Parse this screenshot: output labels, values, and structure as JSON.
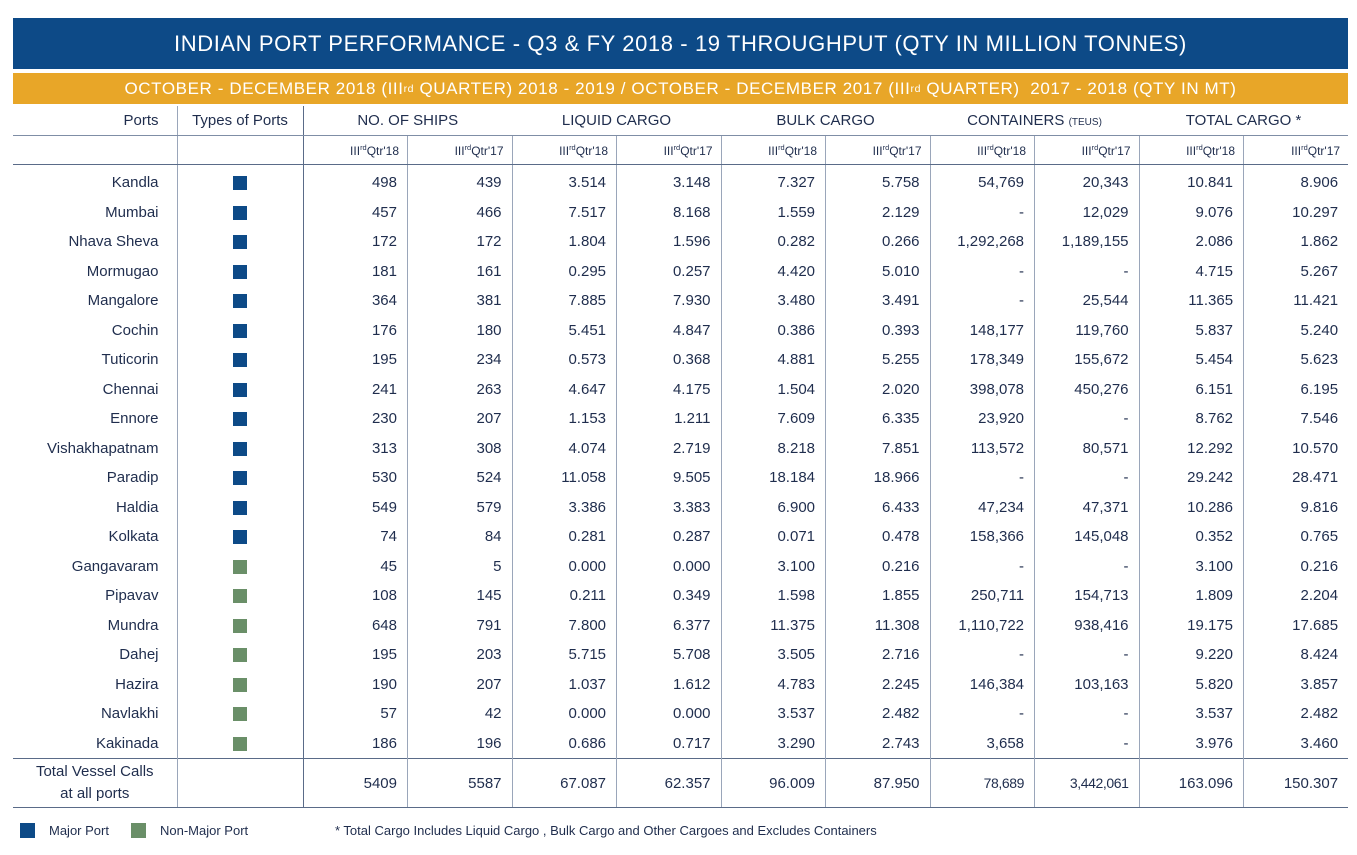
{
  "title": "INDIAN PORT PERFORMANCE - Q3 & FY 2018 - 19 THROUGHPUT (QTY IN MILLION TONNES)",
  "subtitle": {
    "part1": "OCTOBER - DECEMBER 2018 (III",
    "sup1": "rd",
    "part2": " QUARTER) 2018 - 2019 / OCTOBER - DECEMBER 2017 (III",
    "sup2": "rd",
    "part3": " QUARTER)  2017 - 2018 (QTY IN MT)"
  },
  "colors": {
    "title_bg": "#0d4a87",
    "subtitle_bg": "#e8a628",
    "major": "#0d4a87",
    "non_major": "#6a8f68"
  },
  "headers": {
    "ports": "Ports",
    "types": "Types of Ports",
    "ships": "NO. OF SHIPS",
    "liquid": "LIQUID CARGO",
    "bulk": "BULK CARGO",
    "containers": "CONTAINERS",
    "containers_unit": "(TEUS)",
    "total": "TOTAL CARGO *",
    "q18_prefix": "III",
    "q18_sup": "rd",
    "q18_suffix": "Qtr'18",
    "q17_prefix": "III",
    "q17_sup": "rd",
    "q17_suffix": "Qtr'17"
  },
  "rows": [
    [
      "Kandla",
      "major",
      "498",
      "439",
      "3.514",
      "3.148",
      "7.327",
      "5.758",
      "54,769",
      "20,343",
      "10.841",
      "8.906"
    ],
    [
      "Mumbai",
      "major",
      "457",
      "466",
      "7.517",
      "8.168",
      "1.559",
      "2.129",
      "-",
      "12,029",
      "9.076",
      "10.297"
    ],
    [
      "Nhava Sheva",
      "major",
      "172",
      "172",
      "1.804",
      "1.596",
      "0.282",
      "0.266",
      "1,292,268",
      "1,189,155",
      "2.086",
      "1.862"
    ],
    [
      "Mormugao",
      "major",
      "181",
      "161",
      "0.295",
      "0.257",
      "4.420",
      "5.010",
      "-",
      "-",
      "4.715",
      "5.267"
    ],
    [
      "Mangalore",
      "major",
      "364",
      "381",
      "7.885",
      "7.930",
      "3.480",
      "3.491",
      "-",
      "25,544",
      "11.365",
      "11.421"
    ],
    [
      "Cochin",
      "major",
      "176",
      "180",
      "5.451",
      "4.847",
      "0.386",
      "0.393",
      "148,177",
      "119,760",
      "5.837",
      "5.240"
    ],
    [
      "Tuticorin",
      "major",
      "195",
      "234",
      "0.573",
      "0.368",
      "4.881",
      "5.255",
      "178,349",
      "155,672",
      "5.454",
      "5.623"
    ],
    [
      "Chennai",
      "major",
      "241",
      "263",
      "4.647",
      "4.175",
      "1.504",
      "2.020",
      "398,078",
      "450,276",
      "6.151",
      "6.195"
    ],
    [
      "Ennore",
      "major",
      "230",
      "207",
      "1.153",
      "1.211",
      "7.609",
      "6.335",
      "23,920",
      "-",
      "8.762",
      "7.546"
    ],
    [
      "Vishakhapatnam",
      "major",
      "313",
      "308",
      "4.074",
      "2.719",
      "8.218",
      "7.851",
      "113,572",
      "80,571",
      "12.292",
      "10.570"
    ],
    [
      "Paradip",
      "major",
      "530",
      "524",
      "11.058",
      "9.505",
      "18.184",
      "18.966",
      "-",
      "-",
      "29.242",
      "28.471"
    ],
    [
      "Haldia",
      "major",
      "549",
      "579",
      "3.386",
      "3.383",
      "6.900",
      "6.433",
      "47,234",
      "47,371",
      "10.286",
      "9.816"
    ],
    [
      "Kolkata",
      "major",
      "74",
      "84",
      "0.281",
      "0.287",
      "0.071",
      "0.478",
      "158,366",
      "145,048",
      "0.352",
      "0.765"
    ],
    [
      "Gangavaram",
      "non_major",
      "45",
      "5",
      "0.000",
      "0.000",
      "3.100",
      "0.216",
      "-",
      "-",
      "3.100",
      "0.216"
    ],
    [
      "Pipavav",
      "non_major",
      "108",
      "145",
      "0.211",
      "0.349",
      "1.598",
      "1.855",
      "250,711",
      "154,713",
      "1.809",
      "2.204"
    ],
    [
      "Mundra",
      "non_major",
      "648",
      "791",
      "7.800",
      "6.377",
      "11.375",
      "11.308",
      "1,110,722",
      "938,416",
      "19.175",
      "17.685"
    ],
    [
      "Dahej",
      "non_major",
      "195",
      "203",
      "5.715",
      "5.708",
      "3.505",
      "2.716",
      "-",
      "-",
      "9.220",
      "8.424"
    ],
    [
      "Hazira",
      "non_major",
      "190",
      "207",
      "1.037",
      "1.612",
      "4.783",
      "2.245",
      "146,384",
      "103,163",
      "5.820",
      "3.857"
    ],
    [
      "Navlakhi",
      "non_major",
      "57",
      "42",
      "0.000",
      "0.000",
      "3.537",
      "2.482",
      "-",
      "-",
      "3.537",
      "2.482"
    ],
    [
      "Kakinada",
      "non_major",
      "186",
      "196",
      "0.686",
      "0.717",
      "3.290",
      "2.743",
      "3,658",
      "-",
      "3.976",
      "3.460"
    ]
  ],
  "total": {
    "label_line1": "Total Vessel Calls",
    "label_line2": "at all ports",
    "values": [
      "5409",
      "5587",
      "67.087",
      "62.357",
      "96.009",
      "87.950",
      "78,689",
      "3,442,061",
      "163.096",
      "150.307"
    ]
  },
  "legend": {
    "major": "Major Port",
    "non_major": "Non-Major Port"
  },
  "note": "* Total Cargo Includes Liquid Cargo , Bulk Cargo and Other Cargoes and Excludes Containers"
}
